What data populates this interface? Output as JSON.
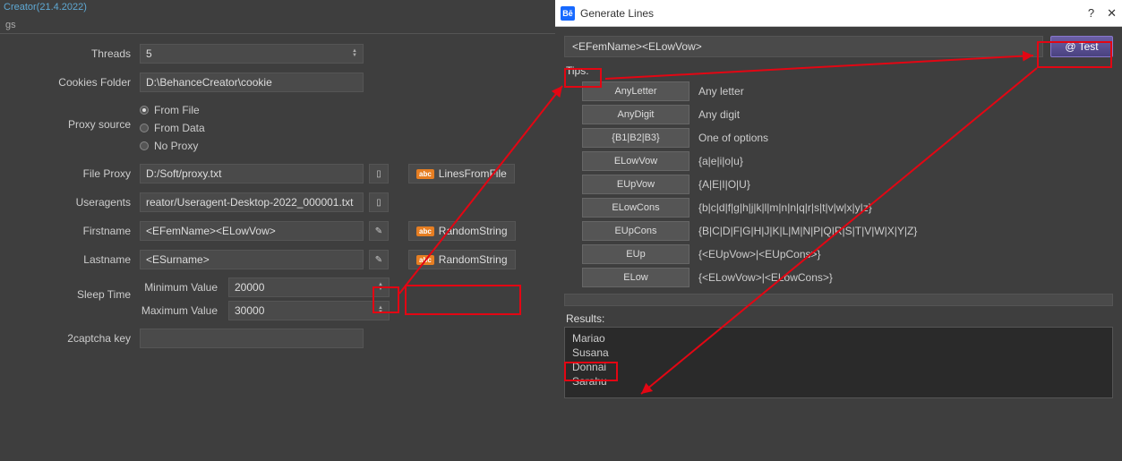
{
  "left": {
    "title": "Creator(21.4.2022)",
    "tab": "gs",
    "threads": {
      "label": "Threads",
      "value": "5"
    },
    "cookies": {
      "label": "Cookies Folder",
      "value": "D:\\BehanceCreator\\cookie"
    },
    "proxy_source": {
      "label": "Proxy source",
      "options": [
        {
          "label": "From File",
          "checked": true
        },
        {
          "label": "From Data",
          "checked": false
        },
        {
          "label": "No Proxy",
          "checked": false
        }
      ]
    },
    "file_proxy": {
      "label": "File Proxy",
      "value": "D:/Soft/proxy.txt",
      "tag": "LinesFromFile"
    },
    "useragents": {
      "label": "Useragents",
      "value": "reator/Useragent-Desktop-2022_000001.txt"
    },
    "firstname": {
      "label": "Firstname",
      "value": "<EFemName><ELowVow>",
      "tag": "RandomString"
    },
    "lastname": {
      "label": "Lastname",
      "value": "<ESurname>",
      "tag": "RandomString"
    },
    "sleep": {
      "label": "Sleep Time",
      "min_label": "Minimum Value",
      "min": "20000",
      "max_label": "Maximum Value",
      "max": "30000"
    },
    "captcha": {
      "label": "2captcha key",
      "value": ""
    }
  },
  "right": {
    "title": "Generate Lines",
    "expression": "<EFemName><ELowVow>",
    "test_label": "Test",
    "tips_label": "Tips:",
    "tips": [
      {
        "btn": "AnyLetter",
        "desc": "Any letter"
      },
      {
        "btn": "AnyDigit",
        "desc": "Any digit"
      },
      {
        "btn": "{B1|B2|B3}",
        "desc": "One of options"
      },
      {
        "btn": "ELowVow",
        "desc": "{a|e|i|o|u}"
      },
      {
        "btn": "EUpVow",
        "desc": "{A|E|I|O|U}"
      },
      {
        "btn": "ELowCons",
        "desc": "{b|c|d|f|g|h|j|k|l|m|n|n|q|r|s|t|v|w|x|y|z}"
      },
      {
        "btn": "EUpCons",
        "desc": "{B|C|D|F|G|H|J|K|L|M|N|P|Q|R|S|T|V|W|X|Y|Z}"
      },
      {
        "btn": "EUp",
        "desc": "{<EUpVow>|<EUpCons>}"
      },
      {
        "btn": "ELow",
        "desc": "{<ELowVow>|<ELowCons>}"
      }
    ],
    "results_label": "Results:",
    "results": [
      "Mariao",
      "Susana",
      "Donnai",
      "Sarahu"
    ]
  }
}
